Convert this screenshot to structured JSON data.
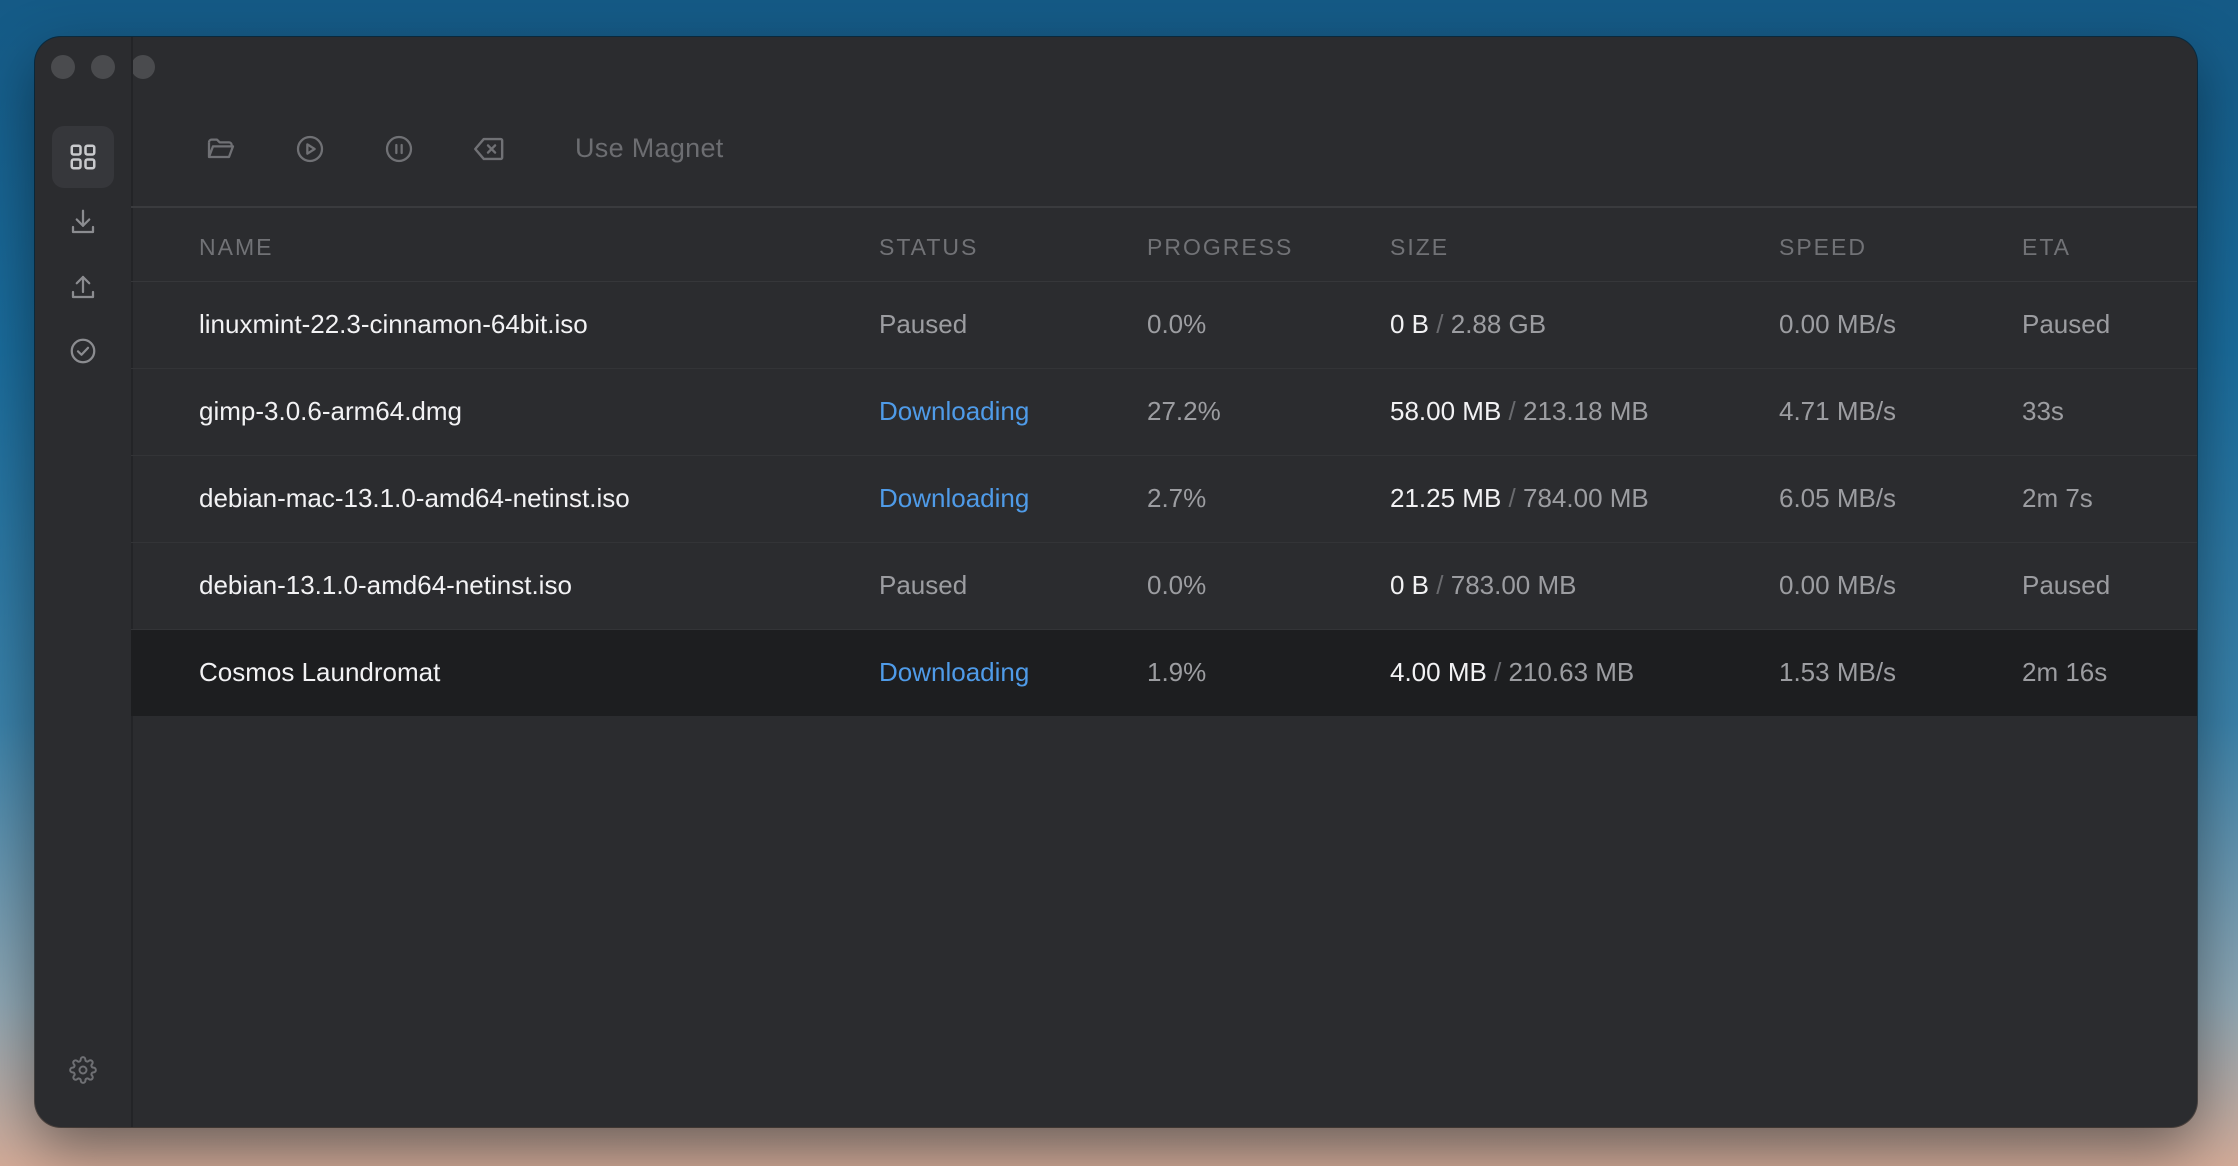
{
  "toolbar": {
    "magnet_label": "Use Magnet"
  },
  "sidebar": {
    "items": [
      {
        "icon": "grid-icon",
        "active": true
      },
      {
        "icon": "download-icon",
        "active": false
      },
      {
        "icon": "upload-icon",
        "active": false
      },
      {
        "icon": "check-circle-icon",
        "active": false
      }
    ],
    "footer_icon": "gear-icon"
  },
  "table": {
    "headers": {
      "name": "NAME",
      "status": "STATUS",
      "progress": "PROGRESS",
      "size": "SIZE",
      "speed": "SPEED",
      "eta": "ETA"
    },
    "rows": [
      {
        "name": "linuxmint-22.3-cinnamon-64bit.iso",
        "status": "Paused",
        "progress": "0.0%",
        "downloaded": "0 B",
        "sep": "/",
        "total": "2.88 GB",
        "speed": "0.00 MB/s",
        "eta": "Paused"
      },
      {
        "name": "gimp-3.0.6-arm64.dmg",
        "status": "Downloading",
        "progress": "27.2%",
        "downloaded": "58.00 MB",
        "sep": "/",
        "total": "213.18 MB",
        "speed": "4.71 MB/s",
        "eta": "33s"
      },
      {
        "name": "debian-mac-13.1.0-amd64-netinst.iso",
        "status": "Downloading",
        "progress": "2.7%",
        "downloaded": "21.25 MB",
        "sep": "/",
        "total": "784.00 MB",
        "speed": "6.05 MB/s",
        "eta": "2m 7s"
      },
      {
        "name": "debian-13.1.0-amd64-netinst.iso",
        "status": "Paused",
        "progress": "0.0%",
        "downloaded": "0 B",
        "sep": "/",
        "total": "783.00 MB",
        "speed": "0.00 MB/s",
        "eta": "Paused"
      },
      {
        "name": "Cosmos Laundromat",
        "status": "Downloading",
        "progress": "1.9%",
        "downloaded": "4.00 MB",
        "sep": "/",
        "total": "210.63 MB",
        "speed": "1.53 MB/s",
        "eta": "2m 16s",
        "selected": true
      }
    ]
  },
  "colors": {
    "downloading": "#4f9be8",
    "window_bg": "#2b2c2f",
    "selected_row": "#1d1e20"
  }
}
